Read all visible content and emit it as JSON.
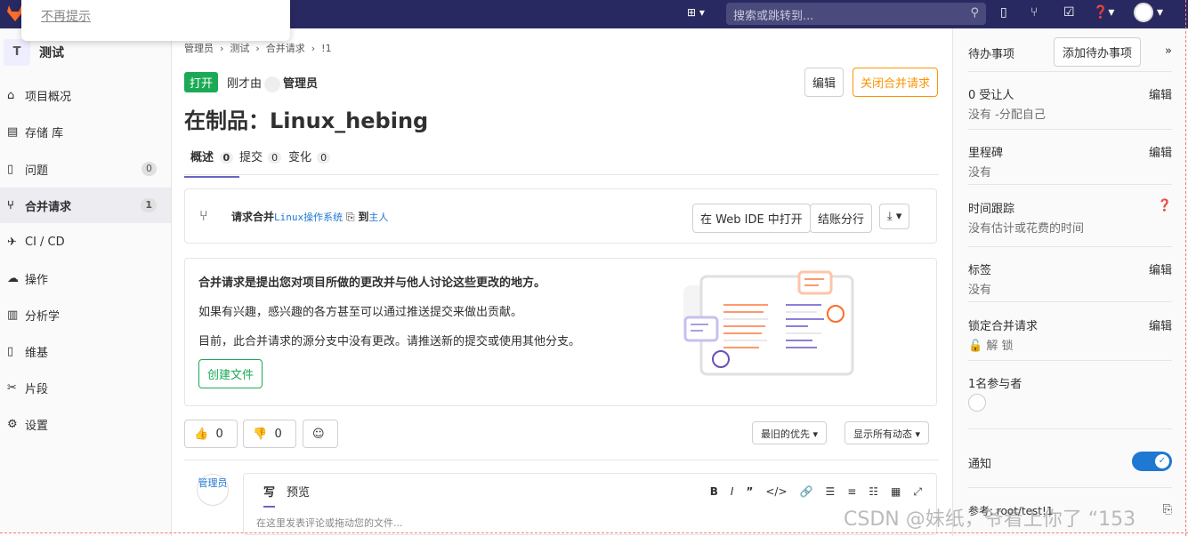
{
  "popup": {
    "link": "不再提示"
  },
  "topbar": {
    "search_placeholder": "搜索或跳转到..."
  },
  "sidebar": {
    "project_initial": "T",
    "project_name": "测试",
    "items": [
      {
        "icon": "home-icon",
        "label": "项目概况"
      },
      {
        "icon": "doc-icon",
        "label": "存储 库"
      },
      {
        "icon": "issues-icon",
        "label": "问题",
        "count": "0"
      },
      {
        "icon": "merge-request-icon",
        "label": "合并请求",
        "count": "1",
        "active": true
      },
      {
        "icon": "rocket-icon",
        "label": "CI / CD"
      },
      {
        "icon": "cloud-icon",
        "label": "操作"
      },
      {
        "icon": "chart-icon",
        "label": "分析学"
      },
      {
        "icon": "book-icon",
        "label": "维基"
      },
      {
        "icon": "scissors-icon",
        "label": "片段"
      },
      {
        "icon": "settings-icon",
        "label": "设置"
      }
    ]
  },
  "breadcrumbs": [
    "管理员",
    "测试",
    "合并请求",
    "!1"
  ],
  "mr": {
    "status": "打开",
    "created_prefix": "刚才由",
    "author": "管理员",
    "edit": "编辑",
    "close": "关闭合并请求",
    "title": "在制品：Linux_hebing",
    "tabs": [
      {
        "label": "概述",
        "count": "0"
      },
      {
        "label": "提交",
        "count": "0"
      },
      {
        "label": "变化",
        "count": "0"
      }
    ],
    "request_label": "请求合并",
    "source_branch": "Linux操作系统",
    "to_label": "到",
    "target_branch": "主人",
    "open_ide": "在 Web IDE 中打开",
    "checkout": "结账分行"
  },
  "info": {
    "heading": "合并请求是提出您对项目所做的更改并与他人讨论这些更改的地方。",
    "p1": "如果有兴趣，感兴趣的各方甚至可以通过推送提交来做出贡献。",
    "p2": "目前，此合并请求的源分支中没有更改。请推送新的提交或使用其他分支。",
    "create_file": "创建文件"
  },
  "reactions": {
    "thumbs_up": "0",
    "thumbs_down": "0"
  },
  "sort": {
    "order": "最旧的优先",
    "filter": "显示所有动态"
  },
  "comment": {
    "avatar_alt": "管理员",
    "write": "写",
    "preview": "预览",
    "placeholder": "在这里发表评论或拖动您的文件..."
  },
  "right_sidebar": {
    "todo": "待办事项",
    "add_todo": "添加待办事项",
    "assignee_title": "0 受让人",
    "assignee_value": "没有 -分配自己",
    "milestone_title": "里程碑",
    "milestone_value": "没有",
    "time_title": "时间跟踪",
    "time_value": "没有估计或花费的时间",
    "labels_title": "标签",
    "labels_value": "没有",
    "lock_title": "锁定合并请求",
    "lock_value": "解 锁",
    "participants_title": "1名参与者",
    "notify_title": "通知",
    "reference": "参考: root/test!1",
    "edit": "编辑"
  },
  "watermark": "CSDN @妹纸，爷看上你了 “153"
}
